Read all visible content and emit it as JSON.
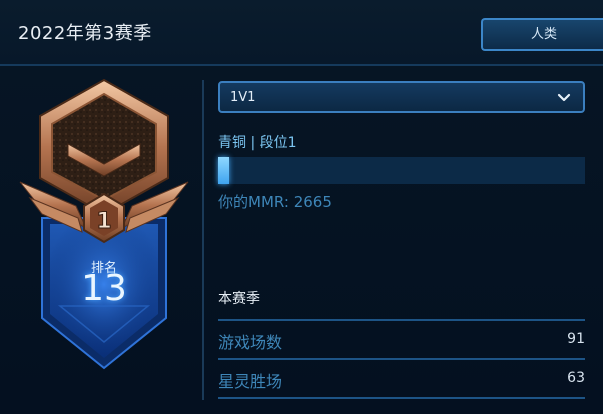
{
  "header": {
    "season_title": "2022年第3赛季",
    "race_tab": "人类"
  },
  "badge": {
    "tier_numeral": "1",
    "rank_label": "排名",
    "rank_number": "13"
  },
  "mode_select": {
    "value": "1V1"
  },
  "league": {
    "text": "青铜 | 段位1",
    "progress_fraction": 0.03
  },
  "mmr": {
    "label": "你的MMR:",
    "value": "2665"
  },
  "season_stats": {
    "title": "本赛季",
    "rows": [
      {
        "label": "游戏场数",
        "value": "91"
      },
      {
        "label": "星灵胜场",
        "value": "63"
      }
    ]
  },
  "colors": {
    "accent_blue": "#3b7fbf",
    "bronze": "#b6764f",
    "progress": "#5fbcf8"
  }
}
